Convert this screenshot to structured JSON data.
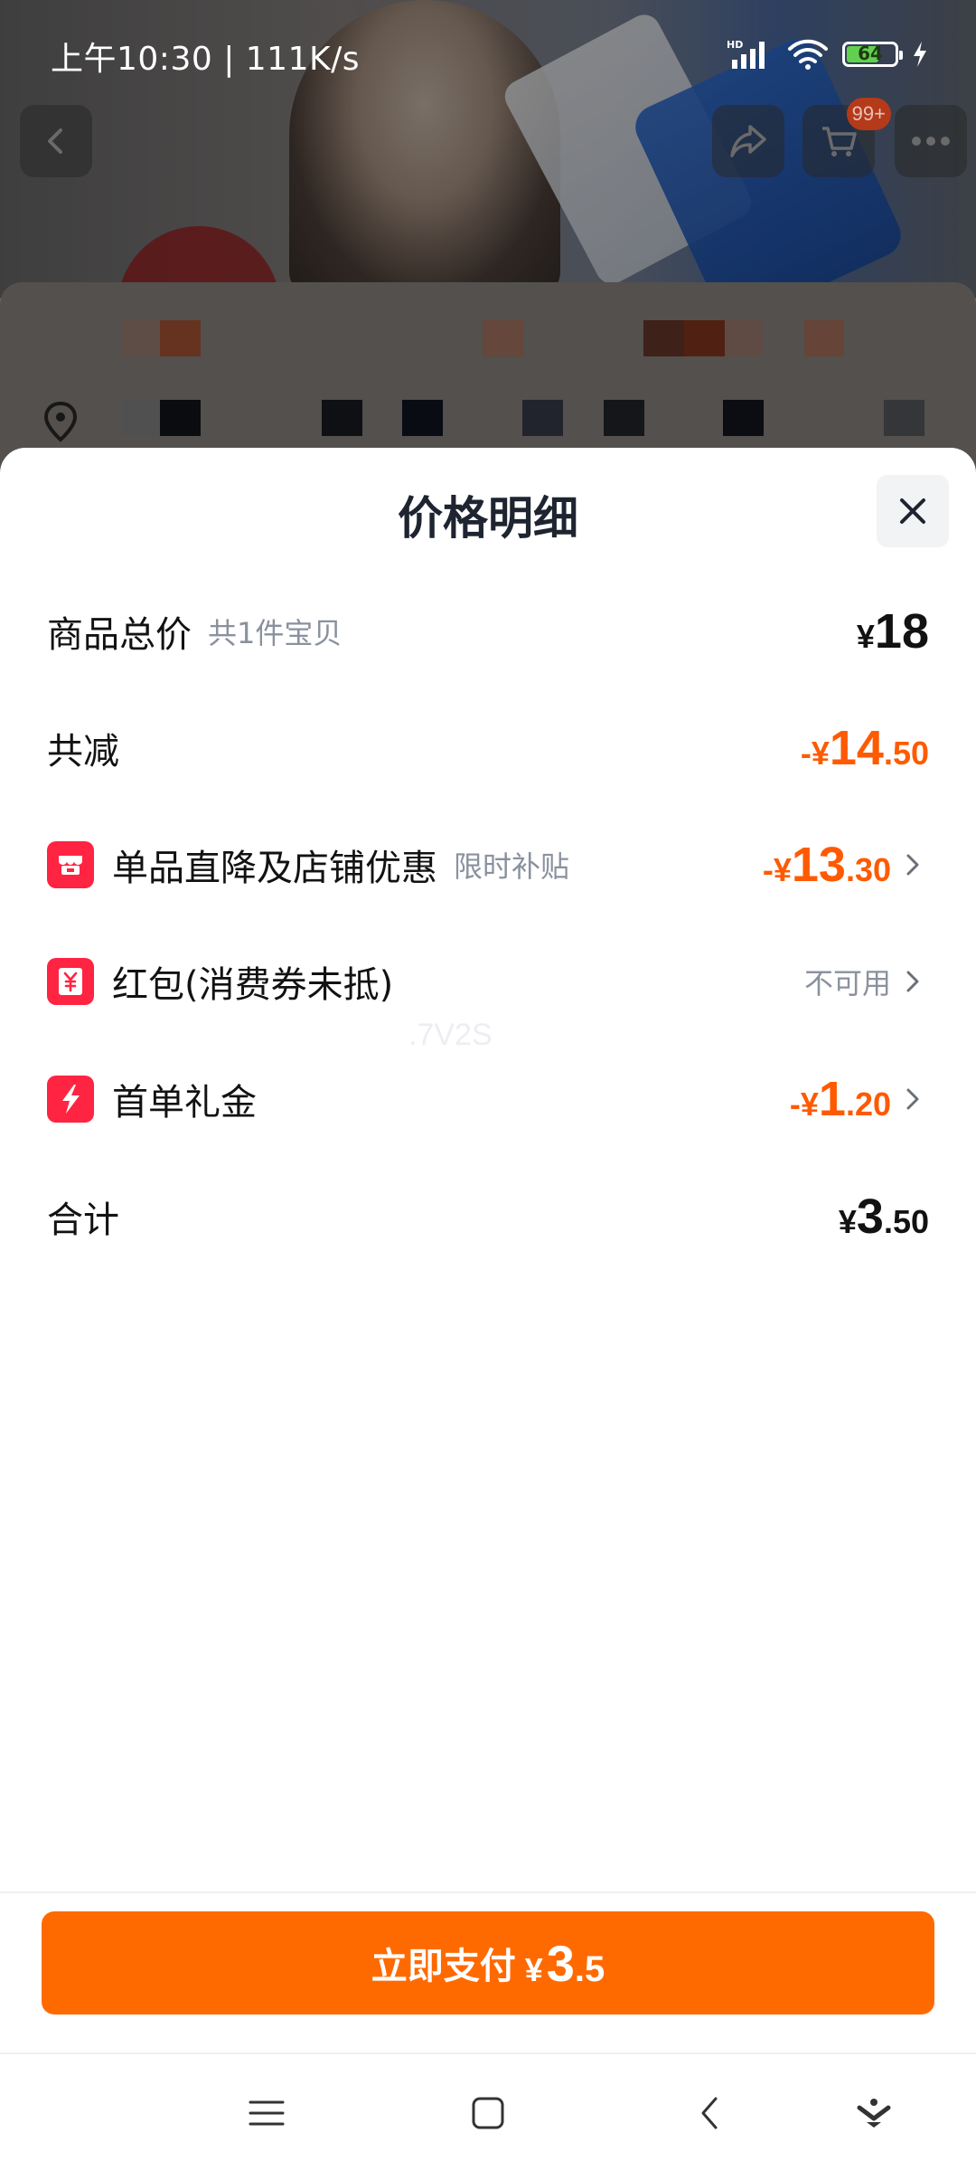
{
  "status_bar": {
    "time": "上午10:30 | 111K/s",
    "network_badge": "HD",
    "battery_level": "64",
    "icons": [
      "signal-icon",
      "wifi-icon",
      "battery-icon",
      "charging-icon"
    ]
  },
  "background": {
    "cart_badge": "99+",
    "nav_icons": [
      "back-icon",
      "share-icon",
      "cart-icon",
      "more-icon"
    ]
  },
  "sheet": {
    "title": "价格明细",
    "close_icon": "close-icon",
    "rows": {
      "subtotal": {
        "label": "商品总价",
        "sub": "共1件宝贝",
        "symbol": "¥",
        "int": "18",
        "dec": ""
      },
      "discount_total": {
        "label": "共减",
        "symbol": "-¥",
        "int": "14",
        "dec": ".50"
      },
      "item_discount": {
        "label": "单品直降及店铺优惠",
        "sub": "限时补贴",
        "symbol": "-¥",
        "int": "13",
        "dec": ".30",
        "icon": "store-icon"
      },
      "red_packet": {
        "label": "红包(消费券未抵)",
        "status": "不可用",
        "icon": "yen-coupon-icon"
      },
      "first_order": {
        "label": "首单礼金",
        "symbol": "-¥",
        "int": "1",
        "dec": ".20",
        "icon": "lightning-icon"
      },
      "total": {
        "label": "合计",
        "symbol": "¥",
        "int": "3",
        "dec": ".50"
      }
    },
    "watermark": ".7V2S"
  },
  "pay": {
    "label": "立即支付",
    "symbol": "¥",
    "int": "3",
    "dec": ".5"
  },
  "system_nav": {
    "icons": [
      "menu-icon",
      "home-icon",
      "back-icon",
      "assistant-icon"
    ]
  },
  "colors": {
    "accent_orange": "#ff6a00",
    "discount_orange": "#ff5a00",
    "icon_red": "#ff2442",
    "text_primary": "#121212",
    "text_secondary": "#8a919e"
  }
}
